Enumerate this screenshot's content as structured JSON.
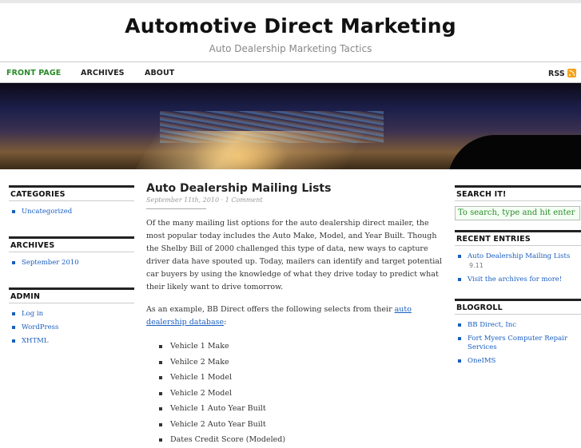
{
  "site": {
    "title": "Automotive Direct Marketing",
    "description": "Auto Dealership Marketing Tactics"
  },
  "nav": {
    "items": [
      {
        "label": "FRONT PAGE",
        "active": true
      },
      {
        "label": "ARCHIVES",
        "active": false
      },
      {
        "label": "ABOUT",
        "active": false
      }
    ],
    "rss_label": "RSS",
    "rss_icon": "rss-icon",
    "accent_color": "#2a8a2a"
  },
  "sidebar_left": {
    "categories": {
      "title": "CATEGORIES",
      "items": [
        "Uncategorized"
      ]
    },
    "archives": {
      "title": "ARCHIVES",
      "items": [
        "September 2010"
      ]
    },
    "admin": {
      "title": "ADMIN",
      "items": [
        "Log in",
        "WordPress",
        "XHTML"
      ]
    }
  },
  "sidebar_right": {
    "search": {
      "title": "SEARCH IT!",
      "placeholder": "To search, type and hit enter"
    },
    "recent": {
      "title": "RECENT ENTRIES",
      "items": [
        {
          "label": "Auto Dealership Mailing Lists",
          "date": "9.11"
        },
        {
          "label": "Visit the archives for more!",
          "date": ""
        }
      ]
    },
    "blogroll": {
      "title": "BLOGROLL",
      "items": [
        "BB Direct, Inc",
        "Fort Myers Computer Repair Services",
        "OneIMS"
      ]
    }
  },
  "post": {
    "title": "Auto Dealership Mailing Lists",
    "date": "September 11th, 2010",
    "separator": "·",
    "comments": "1 Comment",
    "paragraph1": "Of the many mailing list options for the auto dealership direct mailer, the most popular today includes the Auto Make, Model, and Year Built.  Though the Shelby Bill of 2000 challenged this type of data, new ways to capture driver data have spouted up.  Today, mailers can identify and target potential car buyers by using the knowledge of what they drive today to predict what their likely want to drive tomorrow.",
    "paragraph2_prefix": "As an example, BB Direct offers the following selects from their ",
    "paragraph2_link": "auto dealership database",
    "paragraph2_suffix": ":",
    "list": [
      "Vehicle 1 Make",
      "Vehilce 2 Make",
      "Vehicle 1 Model",
      "Vehicle 2 Model",
      "Vehicle 1 Auto Year Built",
      "Vehicle 2 Auto Year Built",
      "Dates Credit Score (Modeled)"
    ]
  }
}
